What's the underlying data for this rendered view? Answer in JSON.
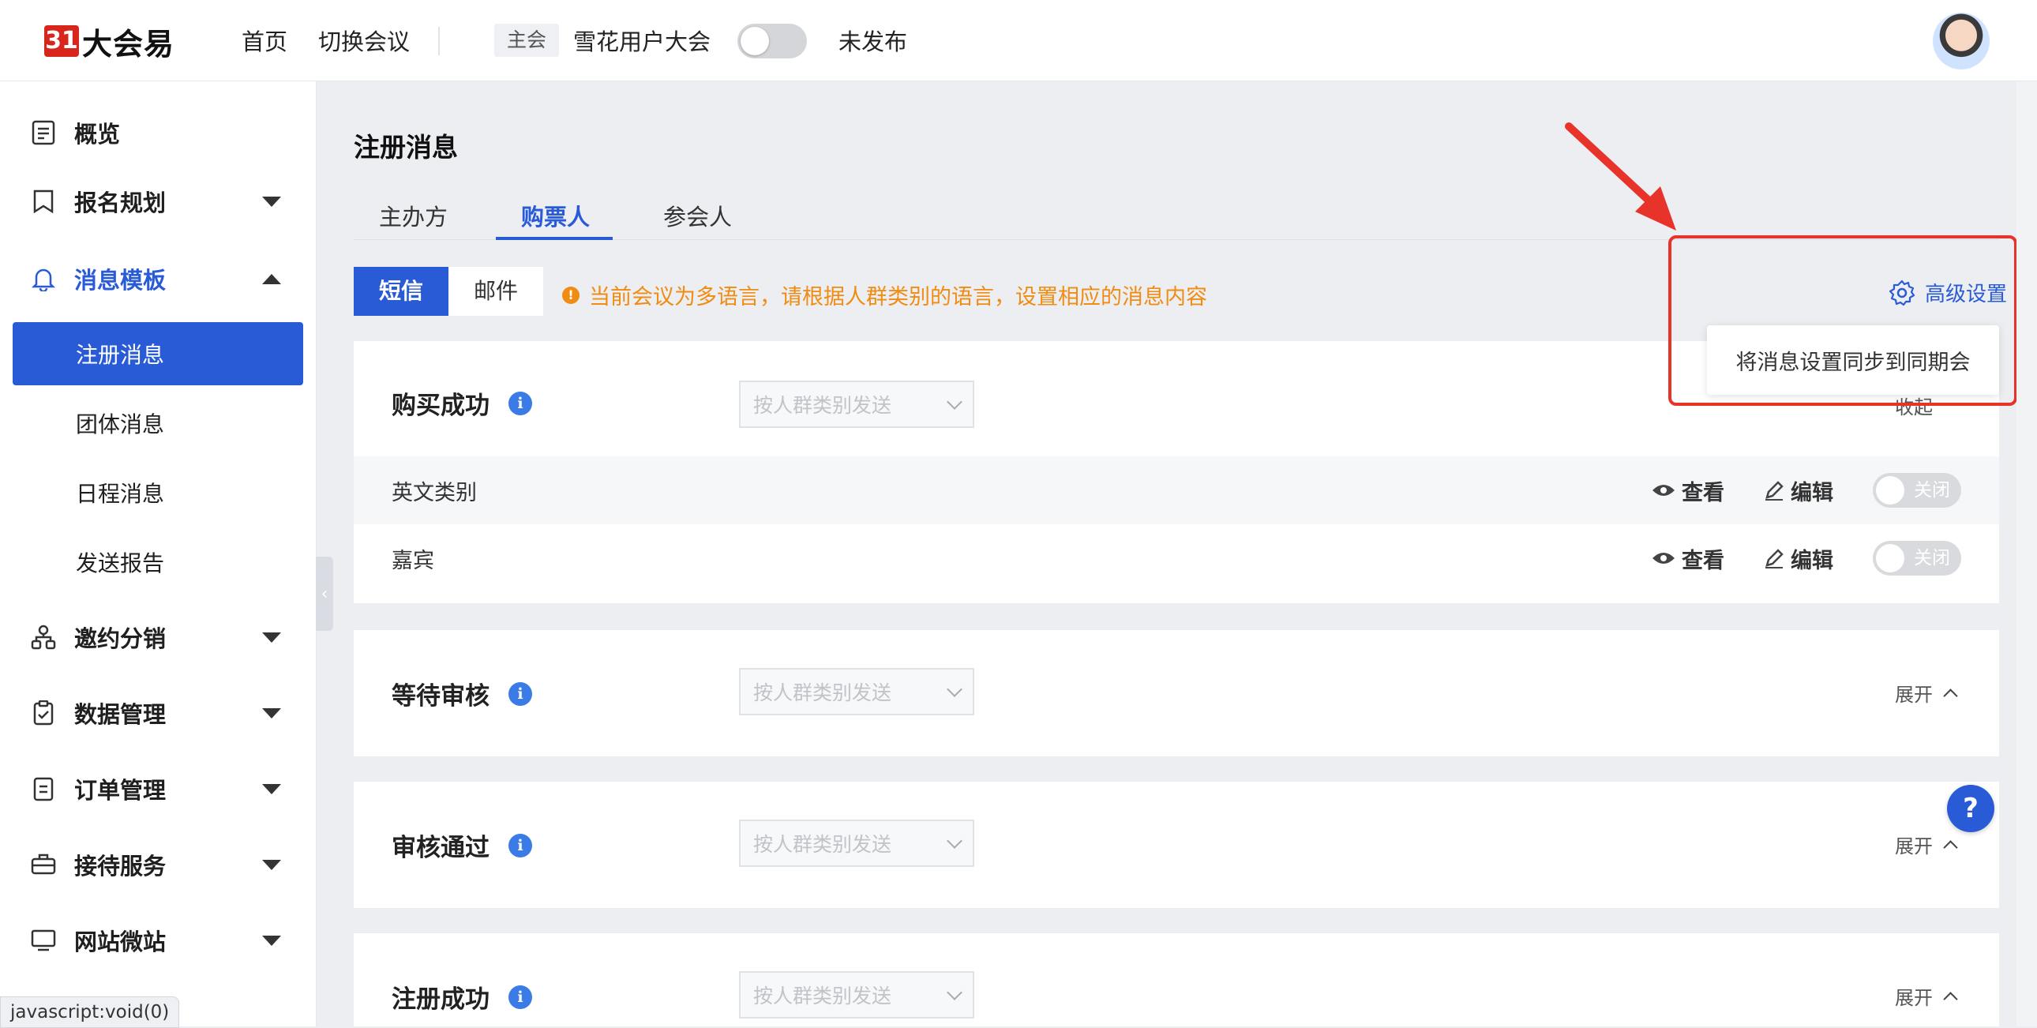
{
  "header": {
    "logo_mark": "31",
    "logo_text": "大会易",
    "nav": [
      "首页",
      "切换会议"
    ],
    "main_tag": "主会",
    "conference_name": "雪花用户大会",
    "publish_status": "未发布"
  },
  "sidebar": {
    "items": [
      {
        "label": "概览",
        "icon": "overview-icon"
      },
      {
        "label": "报名规划",
        "icon": "bookmark-icon"
      },
      {
        "label": "消息模板",
        "icon": "bell-icon"
      },
      {
        "label": "邀约分销",
        "icon": "org-chart-icon"
      },
      {
        "label": "数据管理",
        "icon": "checklist-icon"
      },
      {
        "label": "订单管理",
        "icon": "order-icon"
      },
      {
        "label": "接待服务",
        "icon": "suitcase-icon"
      },
      {
        "label": "网站微站",
        "icon": "monitor-icon"
      }
    ],
    "sub_items": [
      "注册消息",
      "团体消息",
      "日程消息",
      "发送报告"
    ],
    "status_bar": "javascript:void(0)"
  },
  "content": {
    "page_title": "注册消息",
    "tabs": [
      "主办方",
      "购票人",
      "参会人"
    ],
    "channels": [
      "短信",
      "邮件"
    ],
    "notice": "当前会议为多语言，请根据人群类别的语言，设置相应的消息内容",
    "advanced_settings": "高级设置",
    "dropdown_item": "将消息设置同步到同期会",
    "select_placeholder": "按人群类别发送",
    "collapse_label": "收起",
    "expand_label": "展开",
    "view_label": "查看",
    "edit_label": "编辑",
    "off_label": "关闭",
    "sections": [
      {
        "title": "购买成功",
        "rows": [
          "英文类别",
          "嘉宾"
        ]
      },
      {
        "title": "等待审核"
      },
      {
        "title": "审核通过"
      },
      {
        "title": "注册成功"
      }
    ],
    "help": "?"
  },
  "colors": {
    "accent": "#2a5bd7",
    "warning": "#f08c12",
    "annotation": "#e8332a"
  }
}
